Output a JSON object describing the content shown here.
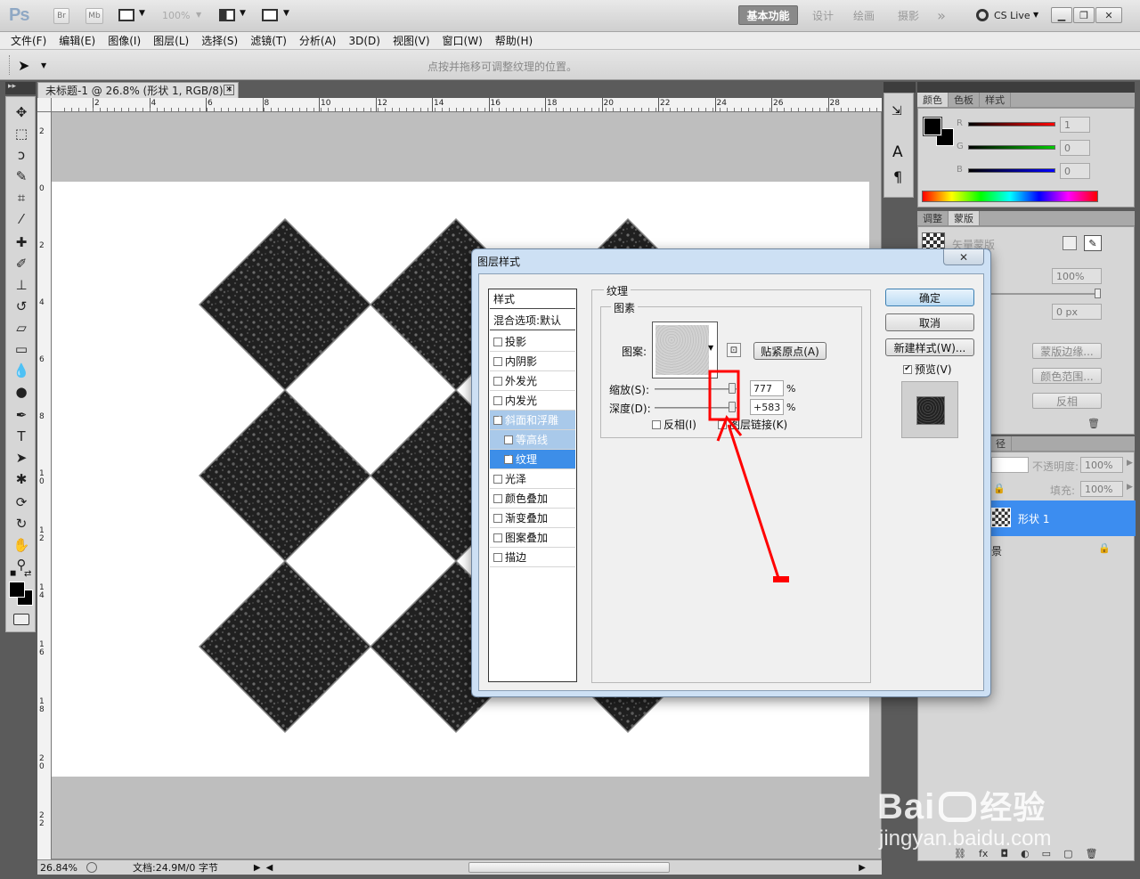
{
  "app": {
    "logo": "Ps",
    "bridge": "Br",
    "minibridge": "Mb",
    "zoom": "100%",
    "cslive": "CS Live"
  },
  "workspaces": {
    "basic": "基本功能",
    "design": "设计",
    "paint": "绘画",
    "photo": "摄影",
    "more": "»"
  },
  "menu": [
    "文件(F)",
    "编辑(E)",
    "图像(I)",
    "图层(L)",
    "选择(S)",
    "滤镜(T)",
    "分析(A)",
    "3D(D)",
    "视图(V)",
    "窗口(W)",
    "帮助(H)"
  ],
  "options": {
    "hint": "点按并拖移可调整纹理的位置。"
  },
  "document": {
    "tab": "未标题-1 @ 26.8% (形状 1, RGB/8) *",
    "zoom": "26.84%",
    "docinfo": "文档:24.9M/0 字节"
  },
  "ruler": {
    "h": [
      "2",
      "4",
      "6",
      "8",
      "10",
      "12",
      "14",
      "16",
      "18",
      "20",
      "22",
      "24",
      "26",
      "28"
    ],
    "v": [
      "2",
      "0",
      "2",
      "4",
      "6",
      "8",
      "1\n0",
      "1\n2",
      "1\n4",
      "1\n6",
      "1\n8",
      "2\n0",
      "2\n2"
    ]
  },
  "dialog": {
    "title": "图层样式",
    "close": "✕",
    "style_header": "样式",
    "blend": "混合选项:默认",
    "styles": [
      {
        "label": "投影",
        "checked": false
      },
      {
        "label": "内阴影",
        "checked": false
      },
      {
        "label": "外发光",
        "checked": false
      },
      {
        "label": "内发光",
        "checked": false
      },
      {
        "label": "斜面和浮雕",
        "checked": true
      },
      {
        "label": "等高线",
        "checked": false
      },
      {
        "label": "纹理",
        "checked": true
      },
      {
        "label": "光泽",
        "checked": false
      },
      {
        "label": "颜色叠加",
        "checked": false
      },
      {
        "label": "渐变叠加",
        "checked": false
      },
      {
        "label": "图案叠加",
        "checked": false
      },
      {
        "label": "描边",
        "checked": false
      }
    ],
    "texture_title": "纹理",
    "elements_title": "图素",
    "pattern_label": "图案:",
    "snap_button": "贴紧原点(A)",
    "scale_label": "缩放(S):",
    "scale_value": "777",
    "scale_unit": "%",
    "depth_label": "深度(D):",
    "depth_value": "+583",
    "depth_unit": "%",
    "invert_label": "反相(I)",
    "link_label": "图层链接(K)",
    "ok": "确定",
    "cancel": "取消",
    "new_style": "新建样式(W)...",
    "preview": "预览(V)"
  },
  "panels": {
    "color_tabs": [
      "颜色",
      "色板",
      "样式"
    ],
    "r": "R",
    "g": "G",
    "b": "B",
    "r_val": "1",
    "g_val": "0",
    "b_val": "0",
    "adj_tabs": [
      "调整",
      "蒙版"
    ],
    "vector_mask": "矢量蒙版",
    "density": "100%",
    "feather": "0 px",
    "mask_edge": "蒙版边缘...",
    "color_range": "颜色范围...",
    "invert": "反相",
    "layers_tab": "径",
    "opacity_label": "不透明度:",
    "opacity": "100%",
    "fill_label": "填充:",
    "fill": "100%",
    "layer_name": "形状 1",
    "bg_layer": "景"
  },
  "watermark": {
    "brand": "Bai",
    "brand2": "经验",
    "url": "jingyan.baidu.com"
  }
}
